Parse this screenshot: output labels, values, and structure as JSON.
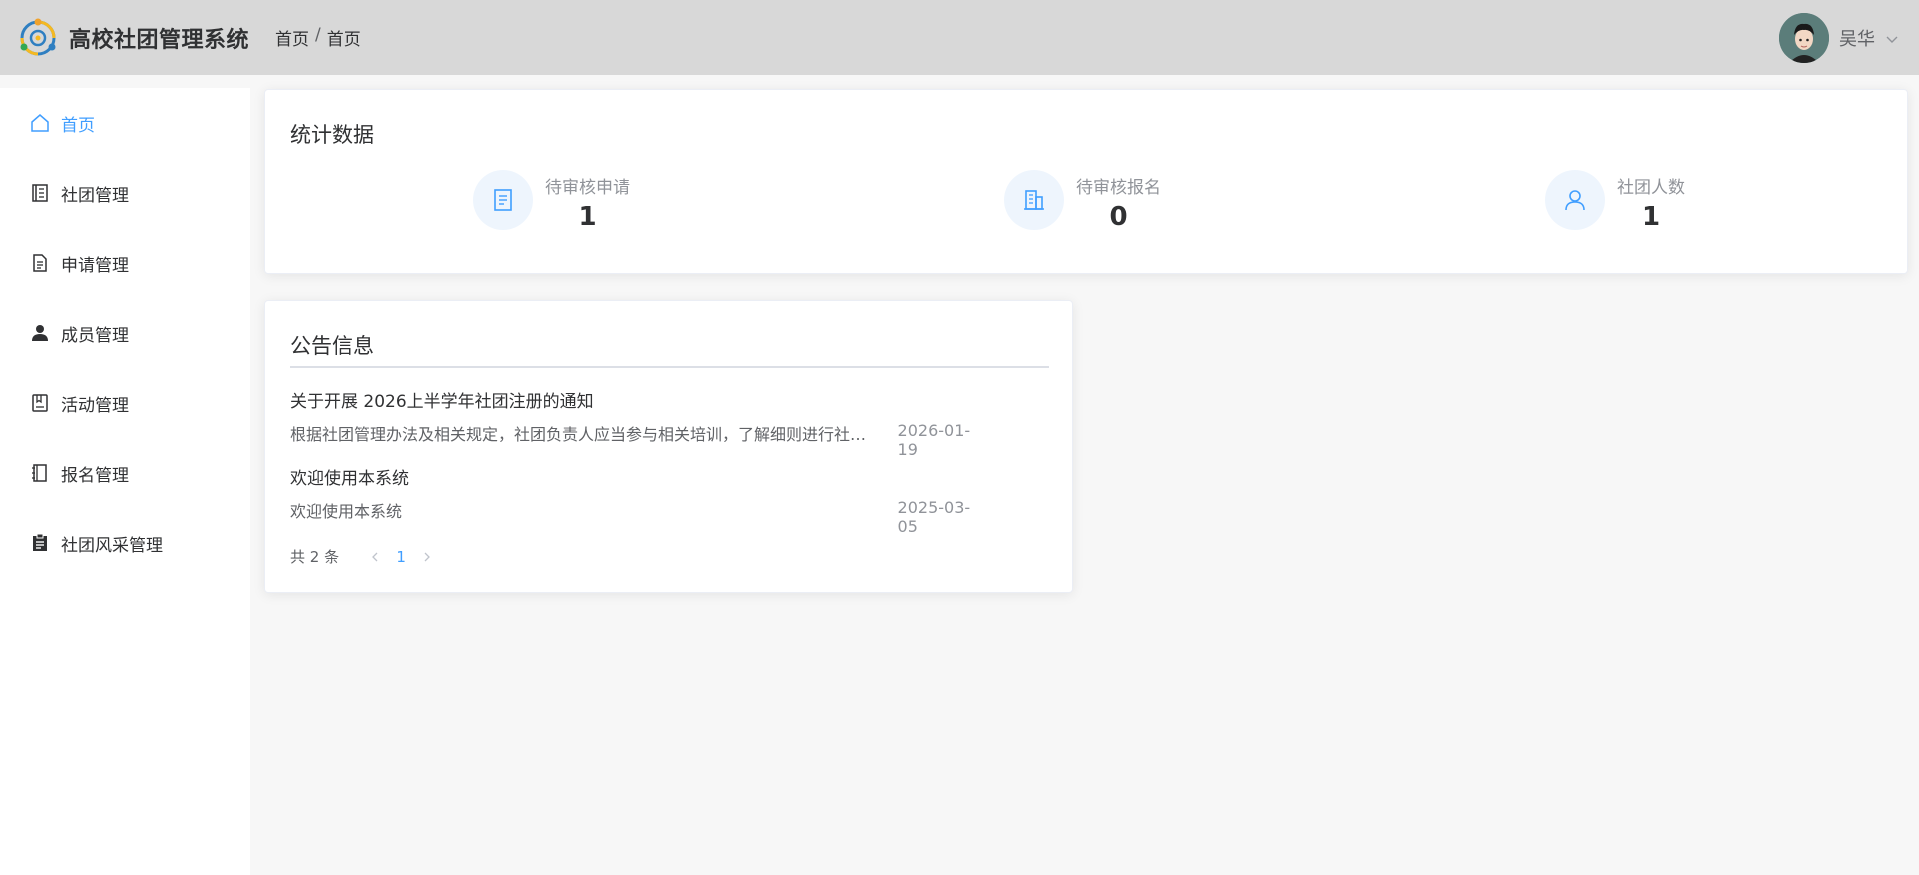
{
  "header": {
    "app_title": "高校社团管理系统",
    "breadcrumb": [
      "首页",
      "首页"
    ],
    "breadcrumb_sep": "/",
    "user_name": "吴华"
  },
  "sidebar": {
    "items": [
      {
        "label": "首页",
        "icon": "home-icon",
        "active": true
      },
      {
        "label": "社团管理",
        "icon": "document-icon",
        "active": false
      },
      {
        "label": "申请管理",
        "icon": "file-text-icon",
        "active": false
      },
      {
        "label": "成员管理",
        "icon": "user-icon",
        "active": false
      },
      {
        "label": "活动管理",
        "icon": "notebook-icon",
        "active": false
      },
      {
        "label": "报名管理",
        "icon": "notebook-2-icon",
        "active": false
      },
      {
        "label": "社团风采管理",
        "icon": "clipboard-icon",
        "active": false
      }
    ]
  },
  "stats": {
    "title": "统计数据",
    "items": [
      {
        "label": "待审核申请",
        "value": "1",
        "icon": "document-icon"
      },
      {
        "label": "待审核报名",
        "value": "0",
        "icon": "office-building-icon"
      },
      {
        "label": "社团人数",
        "value": "1",
        "icon": "user-icon"
      }
    ]
  },
  "notices": {
    "title": "公告信息",
    "items": [
      {
        "title": "关于开展 2026上半学年社团注册的通知",
        "summary": "根据社团管理办法及相关规定，社团负责人应当参与相关培训，了解细则进行社团注册等相关事宜",
        "date": "2026-01-19"
      },
      {
        "title": "欢迎使用本系统",
        "summary": "欢迎使用本系统",
        "date": "2025-03-05"
      }
    ],
    "pagination": {
      "total_text": "共 2 条",
      "current_page": "1"
    }
  },
  "colors": {
    "accent": "#409eff",
    "header_bg": "#d8d8d8",
    "stat_icon_bg": "#eef5fd"
  }
}
